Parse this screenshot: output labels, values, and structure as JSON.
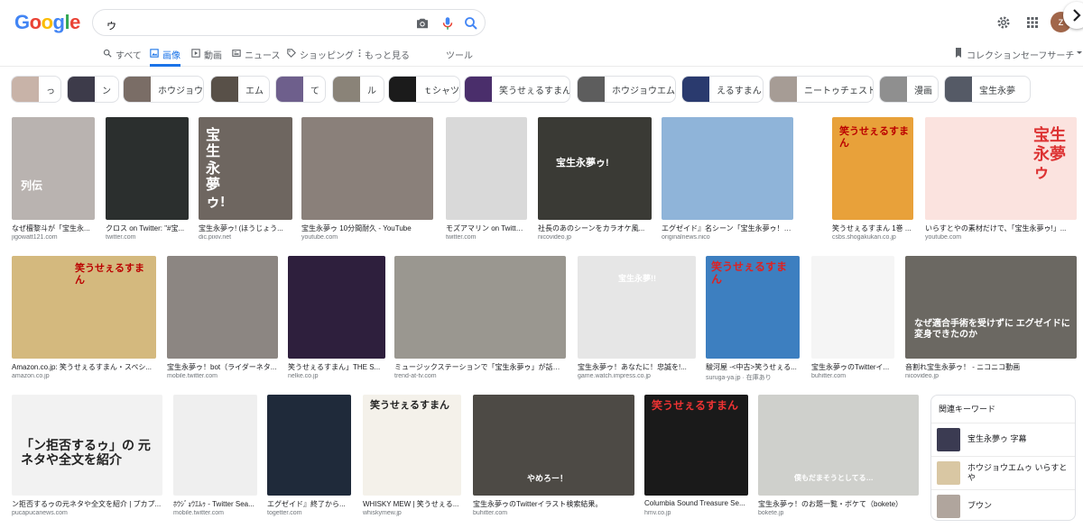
{
  "header": {
    "logo_letters": [
      "G",
      "o",
      "o",
      "g",
      "l",
      "e"
    ],
    "query": "ゥ",
    "avatar_letter": "z",
    "icons": [
      "camera-icon",
      "mic-icon",
      "search-icon",
      "gear-icon",
      "apps-icon"
    ]
  },
  "colors": {
    "logo": [
      "#4285f4",
      "#ea4335",
      "#fbbc05",
      "#4285f4",
      "#34a853",
      "#ea4335"
    ],
    "accent": "#1a73e8"
  },
  "tabs": [
    {
      "label": "すべて",
      "icon": "search-icon"
    },
    {
      "label": "画像",
      "icon": "image-icon",
      "active": true
    },
    {
      "label": "動画",
      "icon": "video-icon"
    },
    {
      "label": "ニュース",
      "icon": "news-icon"
    },
    {
      "label": "ショッピング",
      "icon": "tag-icon"
    },
    {
      "label": "もっと見る",
      "icon": "more-icon"
    },
    {
      "label": "ツール",
      "icon": ""
    }
  ],
  "tabs_right": {
    "collection": "コレクション",
    "safesearch": "セーフサーチ"
  },
  "chips": [
    {
      "label": "っ",
      "color": "#c8b3a8"
    },
    {
      "label": "ン",
      "color": "#3d3b4a"
    },
    {
      "label": "ホウジョウ",
      "color": "#7a6d66"
    },
    {
      "label": "エム",
      "color": "#585048"
    },
    {
      "label": "て",
      "color": "#6e5f8c"
    },
    {
      "label": "ル",
      "color": "#8a8378"
    },
    {
      "label": "ｔシャツ",
      "color": "#1b1b1b"
    },
    {
      "label": "笑うせぇるすまん",
      "color": "#4a2e6b"
    },
    {
      "label": "ホウジョウエム",
      "color": "#5d5d5d"
    },
    {
      "label": "えるすまん",
      "color": "#2a3a6e"
    },
    {
      "label": "ニートゥチェスト",
      "color": "#a69c95"
    },
    {
      "label": "漫画",
      "color": "#8f8f8f"
    },
    {
      "label": "宝生永夢",
      "color": "#555a66"
    }
  ],
  "results": [
    {
      "caption": "なぜ檀黎斗が「宝生永...",
      "source": "jigowatt121.com",
      "color": "#b9b3b0",
      "text": "列伝"
    },
    {
      "caption": "クロス on Twitter: \"#宝...",
      "source": "twitter.com",
      "color": "#2b2f2e",
      "text": ""
    },
    {
      "caption": "宝生永夢ゥ! (ほうじょう...",
      "source": "dic.pixiv.net",
      "color": "#6e6660",
      "text": "宝生永夢ゥ!"
    },
    {
      "caption": "宝生永夢ゥ 10分間耐久 - YouTube",
      "source": "youtube.com",
      "color": "#8a807a",
      "text": ""
    },
    {
      "caption": "モズアマリン on Twitter...",
      "source": "twitter.com",
      "color": "#d9d9d9",
      "text": ""
    },
    {
      "caption": "社長のあのシーンをカラオケ風...",
      "source": "nicovideo.jp",
      "color": "#3a3a35",
      "text": "宝生永夢ゥ!"
    },
    {
      "caption": "エグゼイド』名シーン「宝生永夢ゥ！」を\"い...",
      "source": "originalnews.nico",
      "color": "#8fb4d9",
      "text": ""
    },
    {
      "caption": "笑うせぇるすまん 1巻 ...",
      "source": "csbs.shogakukan.co.jp",
      "color": "#e8a13a",
      "text": "笑うせぇるすまん"
    },
    {
      "caption": "いらすとやの素材だけで、「宝生永夢ゥ!」...",
      "source": "youtube.com",
      "color": "#fbe3df",
      "text": "宝生永夢ゥ"
    },
    {
      "caption": "Amazon.co.jp: 笑うせぇるすまん・スペシ...",
      "source": "amazon.co.jp",
      "color": "#d4b97e",
      "text": "笑うせぇるすまん"
    },
    {
      "caption": "宝生永夢ゥ！bot（ライダーネタ...",
      "source": "mobile.twitter.com",
      "color": "#8c8682",
      "text": ""
    },
    {
      "caption": "笑うせぇるすまん」THE S...",
      "source": "nelke.co.jp",
      "color": "#2e1f3d",
      "text": ""
    },
    {
      "caption": "ミュージックステーションで「宝生永夢ゥ」が話題...",
      "source": "trend-at-tv.com",
      "color": "#9a9790",
      "text": ""
    },
    {
      "caption": "宝生永夢ゥ！あなたに！忠誠を!...",
      "source": "game.watch.impress.co.jp",
      "color": "#e6e6e6",
      "text": "宝生永夢!!"
    },
    {
      "caption": "駿河屋 -<中古>笑うせぇる...",
      "source": "suruga-ya.jp · 在庫あり",
      "color": "#3d7fc0",
      "text": "笑うせぇるすまん"
    },
    {
      "caption": "宝生永夢ゥのTwitterイ...",
      "source": "buhitter.com",
      "color": "#f5f5f5",
      "text": ""
    },
    {
      "caption": "音割れ宝生永夢ゥ！ - ニコニコ動画",
      "source": "nicovideo.jp",
      "color": "#6b6862",
      "text": "なぜ適合手術を受けずに エグゼイドに変身できたのか"
    },
    {
      "caption": "ン拒否するゥの元ネタや全文を紹介 | プカプ...",
      "source": "pucapucanews.com",
      "color": "#f2f2f2",
      "text": "「ン拒否するゥ」の 元ネタや全文を紹介"
    },
    {
      "caption": "ﾎｳｼﾞｮｳｴﾑｩ - Twitter Sea...",
      "source": "mobile.twitter.com",
      "color": "#efefef",
      "text": ""
    },
    {
      "caption": "エグゼイド』終了から...",
      "source": "togetter.com",
      "color": "#1f2a3a",
      "text": ""
    },
    {
      "caption": "WHISKY MEW | 笑うせぇる...",
      "source": "whiskymew.jp",
      "color": "#f4f1ea",
      "text": "笑うせぇるすまん"
    },
    {
      "caption": "宝生永夢ゥのTwitterイラスト検索結果。",
      "source": "buhitter.com",
      "color": "#4d4a45",
      "text": "やめろー！"
    },
    {
      "caption": "Columbia Sound Treasure Se...",
      "source": "hmv.co.jp",
      "color": "#1a1a1a",
      "text": "笑うせぇるすまん"
    },
    {
      "caption": "宝生永夢ゥ！のお題一覧・ボケて（bokete）",
      "source": "bokete.jp",
      "color": "#cfd0cc",
      "text": "僕もだまそうとしてる…"
    }
  ],
  "related": {
    "title": "関連キーワード",
    "items": [
      {
        "label": "宝生永夢ゥ 字幕",
        "color": "#3b3b52"
      },
      {
        "label": "ホウジョウエムゥ いらすとや",
        "color": "#d9c7a3"
      },
      {
        "label": "ブウン",
        "color": "#b0a59d"
      }
    ]
  }
}
